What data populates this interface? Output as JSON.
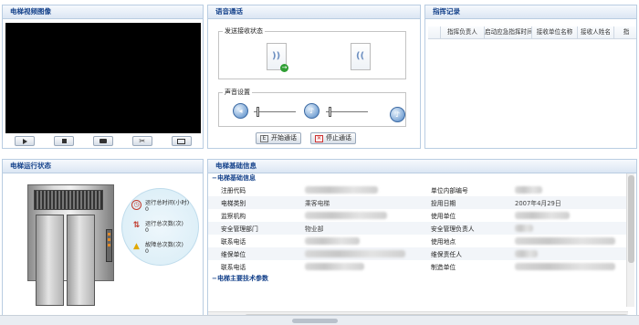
{
  "video": {
    "title": "电梯视频图像",
    "controls": [
      "play-icon",
      "stop-icon",
      "record-icon",
      "snapshot-icon",
      "fullscreen-icon"
    ]
  },
  "voice": {
    "title": "语音通话",
    "send_receive_title": "发送接收状态",
    "volume_title": "声音设置",
    "start_call": "开始通话",
    "stop_call": "停止通话"
  },
  "dispatch": {
    "title": "指挥记录",
    "columns": [
      "指挥负责人",
      "启动应急指挥时间",
      "接收单位名称",
      "接收人姓名",
      "指"
    ]
  },
  "run": {
    "title": "电梯运行状态",
    "items": [
      {
        "icon": "clock-icon",
        "label": "运行总时间(小时)",
        "value": "0"
      },
      {
        "icon": "updown-arrows-icon",
        "label": "运行总次数(次)",
        "value": "0"
      },
      {
        "icon": "warning-icon",
        "label": "故障总次数(次)",
        "value": "0"
      }
    ]
  },
  "info": {
    "title": "电梯基础信息",
    "section1": "电梯基础信息",
    "section2": "电梯主要技术参数",
    "rows": [
      {
        "l1": "注册代码",
        "v1": "",
        "l2": "单位内部编号",
        "v2": ""
      },
      {
        "l1": "电梯类别",
        "v1": "乘客电梯",
        "l2": "投用日期",
        "v2": "2007年4月29日"
      },
      {
        "l1": "监察机构",
        "v1": "",
        "l2": "使用单位",
        "v2": ""
      },
      {
        "l1": "安全管理部门",
        "v1": "物业部",
        "l2": "安全管理负责人",
        "v2": ""
      },
      {
        "l1": "联系电话",
        "v1": "",
        "l2": "使用地点",
        "v2": ""
      },
      {
        "l1": "维保单位",
        "v1": "",
        "l2": "维保责任人",
        "v2": ""
      },
      {
        "l1": "联系电话",
        "v1": "",
        "l2": "制造单位",
        "v2": ""
      }
    ]
  }
}
